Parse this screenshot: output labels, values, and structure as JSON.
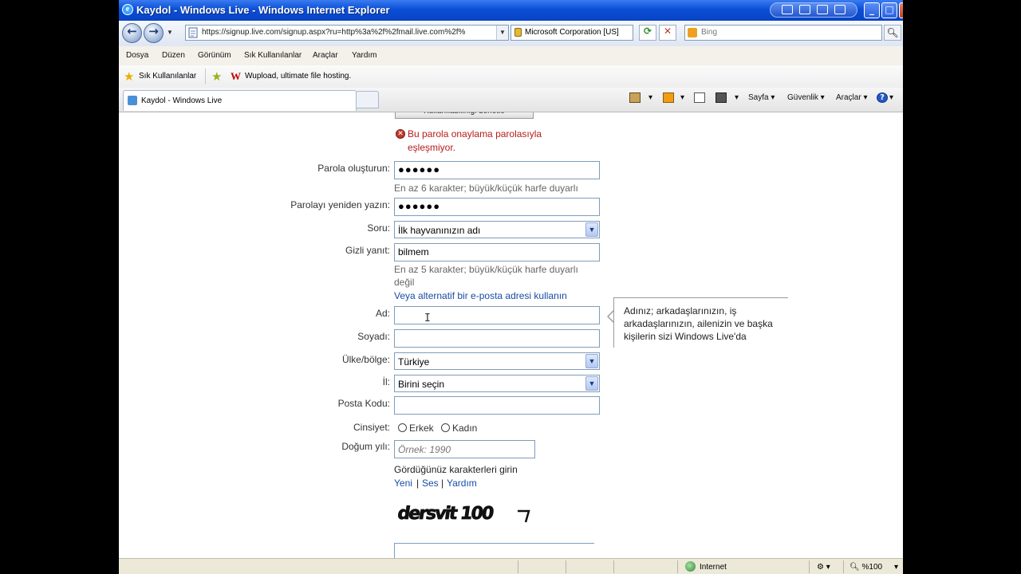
{
  "window": {
    "title": "Kaydol - Windows Live - Windows Internet Explorer",
    "ie_glyph": "e",
    "min": "_",
    "max": "□",
    "close": "✕"
  },
  "address_bar": {
    "url": "https://signup.live.com/signup.aspx?ru=http%3a%2f%2fmail.live.com%2f%",
    "certificate": "Microsoft Corporation [US]",
    "search_placeholder": "Bing",
    "back_icon": "back-arrow-icon",
    "forward_icon": "forward-arrow-icon"
  },
  "menu": [
    "Dosya",
    "Düzen",
    "Görünüm",
    "Sık Kullanılanlar",
    "Araçlar",
    "Yardım"
  ],
  "favorites_bar": {
    "favorites_label": "Sık Kullanılanlar",
    "logo_letter": "W",
    "link": "Wupload, ultimate file hosting."
  },
  "tabs": {
    "active": "Kaydol - Windows Live"
  },
  "command_bar": {
    "page": "Sayfa",
    "safety": "Güvenlik",
    "tools": "Araçlar",
    "help_glyph": "?"
  },
  "form": {
    "check_availability_button": "Kullanılabilirliği denetle",
    "error_line1": "Bu parola onaylama parolasıyla",
    "error_line2": "eşleşmiyor.",
    "error_glyph": "✕",
    "password_label": "Parola oluşturun:",
    "password_value": "●●●●●●",
    "password_hint": "En az 6 karakter; büyük/küçük harfe duyarlı",
    "retype_label": "Parolayı yeniden yazın:",
    "retype_value": "●●●●●●",
    "question_label": "Soru:",
    "question_value": "İlk hayvanınızın adı",
    "answer_label": "Gizli yanıt:",
    "answer_value": "bilmem",
    "answer_hint_line1": "En az 5 karakter; büyük/küçük harfe duyarlı",
    "answer_hint_line2": "değil",
    "alt_email_link": "Veya alternatif bir e-posta adresi kullanın",
    "first_name_label": "Ad:",
    "first_name_value": "",
    "last_name_label": "Soyadı:",
    "last_name_value": "",
    "country_label": "Ülke/bölge:",
    "country_value": "Türkiye",
    "province_label": "İl:",
    "province_value": "Birini seçin",
    "postal_label": "Posta Kodu:",
    "postal_value": "",
    "gender_label": "Cinsiyet:",
    "gender_male": "Erkek",
    "gender_female": "Kadın",
    "birth_label": "Doğum yılı:",
    "birth_placeholder": "Örnek: 1990",
    "captcha_prompt": "Gördüğünüz karakterleri girin",
    "captcha_new": "Yeni",
    "captcha_audio": "Ses",
    "captcha_help": "Yardım",
    "captcha_sep": "|",
    "captcha_text": "dersvit 100"
  },
  "tooltip": {
    "text": "Adınız; arkadaşlarınızın, iş arkadaşlarınızın, ailenizin ve başka kişilerin sizi Windows Live'da"
  },
  "status_bar": {
    "zone": "Internet",
    "zoom": "%100"
  },
  "colors": {
    "title_blue": "#0a4fd6",
    "error_red": "#b71c1c",
    "link_blue": "#1a4ca3"
  }
}
